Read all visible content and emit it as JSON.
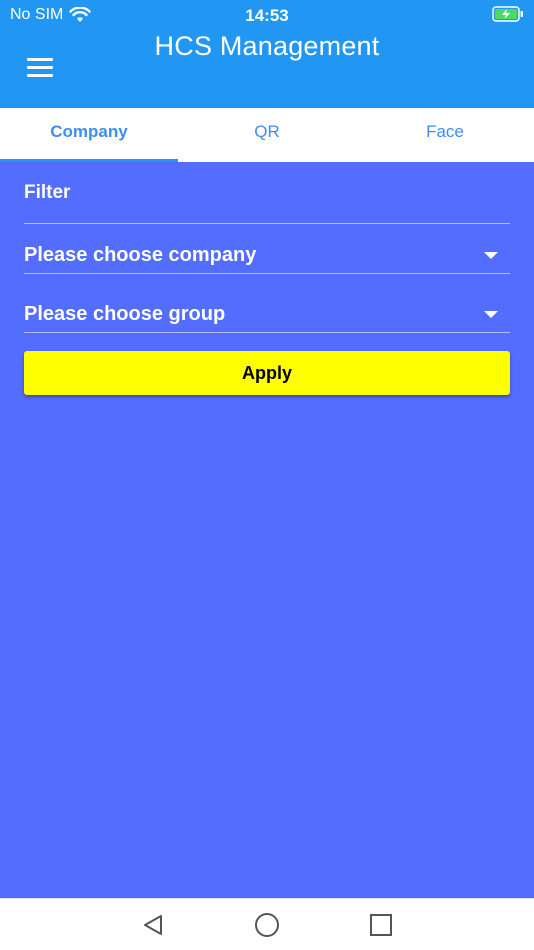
{
  "status_bar": {
    "carrier": "No SIM",
    "time": "14:53",
    "icons": [
      "wifi-icon",
      "battery-charging-icon"
    ]
  },
  "app_bar": {
    "title": "HCS Management",
    "menu_icon": "hamburger-menu-icon"
  },
  "tabs": [
    {
      "label": "Company",
      "active": true
    },
    {
      "label": "QR",
      "active": false
    },
    {
      "label": "Face",
      "active": false
    }
  ],
  "filter": {
    "label": "Filter",
    "company_dropdown": {
      "placeholder": "Please choose company",
      "icon": "caret-down-icon"
    },
    "group_dropdown": {
      "placeholder": "Please choose group",
      "icon": "caret-down-icon"
    },
    "apply_label": "Apply"
  },
  "nav_bar": {
    "icons": [
      "back-icon",
      "home-icon",
      "recents-icon"
    ]
  },
  "colors": {
    "app_bar": "#2196f3",
    "background": "#536dfe",
    "apply_button": "#ffff00",
    "tab_text": "#3d8ef2"
  }
}
